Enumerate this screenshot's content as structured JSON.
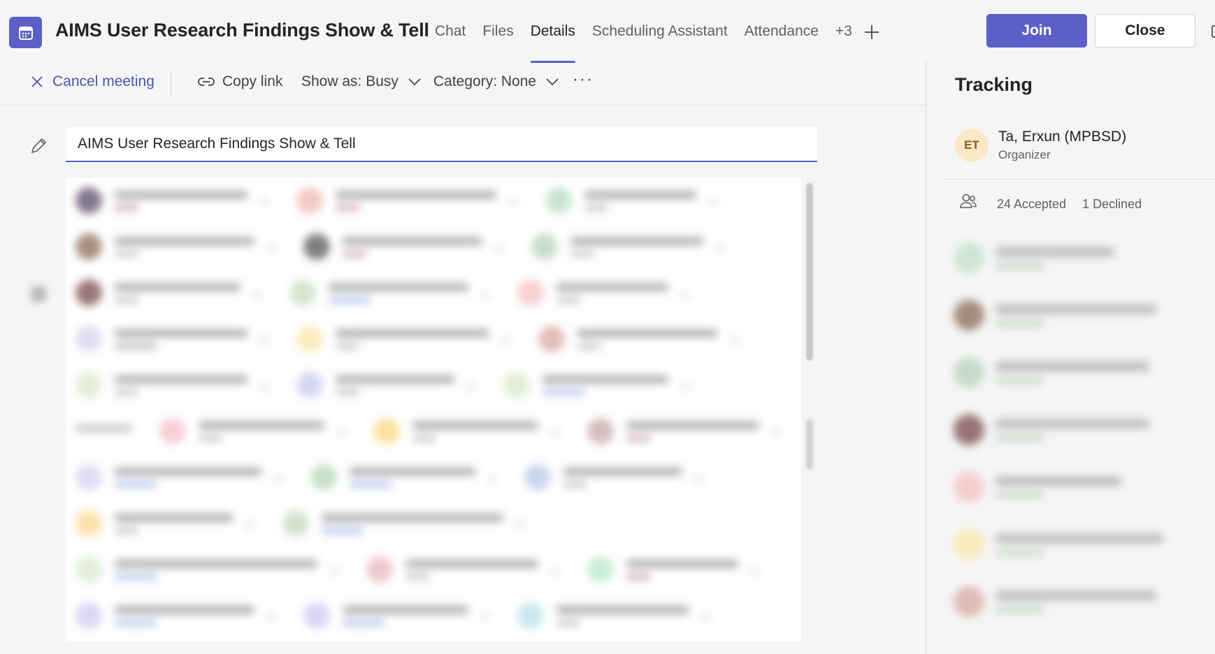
{
  "header": {
    "title": "AIMS User Research Findings Show & Tell",
    "app_icon": "calendar-icon",
    "tabs": [
      {
        "label": "Chat",
        "active": false
      },
      {
        "label": "Files",
        "active": false
      },
      {
        "label": "Details",
        "active": true
      },
      {
        "label": "Scheduling Assistant",
        "active": false
      },
      {
        "label": "Attendance",
        "active": false
      }
    ],
    "more_tabs_label": "+3",
    "join_label": "Join",
    "close_label": "Close",
    "accent_color": "#5b5fc7"
  },
  "toolbar": {
    "cancel_label": "Cancel meeting",
    "copy_link_label": "Copy link",
    "show_as_label": "Show as: Busy",
    "category_label": "Category: None",
    "more_label": "···"
  },
  "details": {
    "title_value": "AIMS User Research Findings Show & Tell"
  },
  "tracking": {
    "heading": "Tracking",
    "organizer": {
      "initials": "ET",
      "name": "Ta, Erxun (MPBSD)",
      "role": "Organizer"
    },
    "accepted_label": "24 Accepted",
    "declined_label": "1 Declined"
  }
}
